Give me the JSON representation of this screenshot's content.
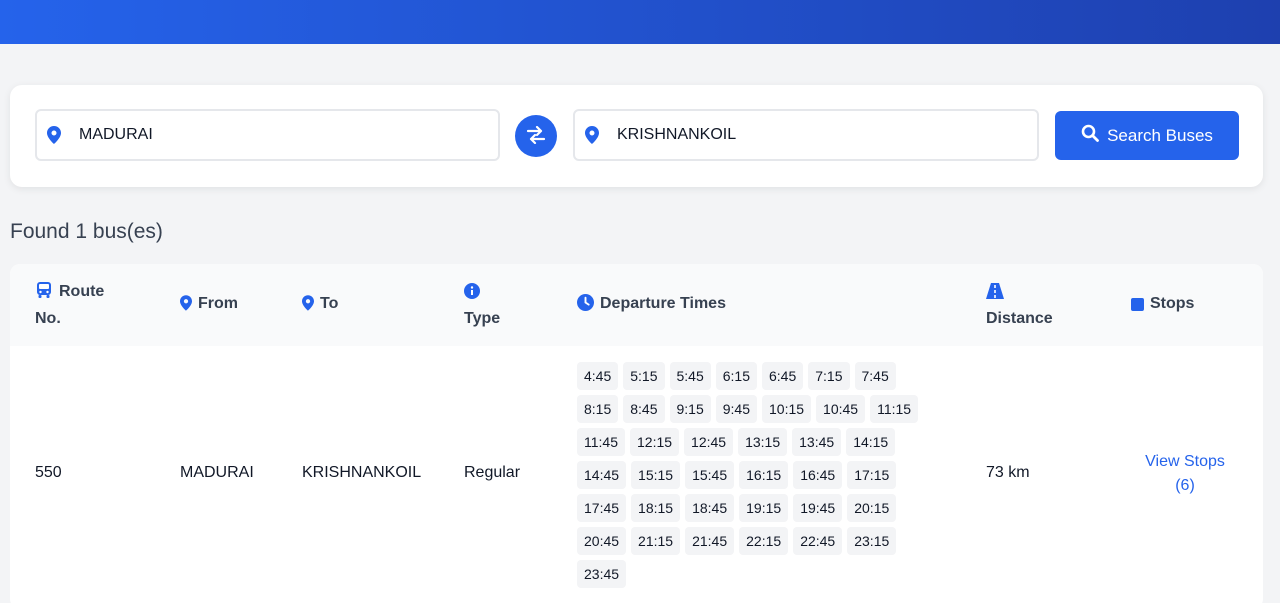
{
  "search": {
    "from_value": "MADURAI",
    "to_value": "KRISHNANKOIL",
    "search_label": "Search Buses"
  },
  "results": {
    "found_text": "Found 1 bus(es)"
  },
  "table": {
    "headers": {
      "route_line1": "Route",
      "route_line2": "No.",
      "from": "From",
      "to": "To",
      "type": "Type",
      "departure": "Departure Times",
      "distance": "Distance",
      "stops": "Stops"
    },
    "row": {
      "route_no": "550",
      "from": "MADURAI",
      "to": "KRISHNANKOIL",
      "type": "Regular",
      "distance": "73 km",
      "view_stops": "View Stops",
      "stops_count": "(6)",
      "times": [
        "4:45",
        "5:15",
        "5:45",
        "6:15",
        "6:45",
        "7:15",
        "7:45",
        "8:15",
        "8:45",
        "9:15",
        "9:45",
        "10:15",
        "10:45",
        "11:15",
        "11:45",
        "12:15",
        "12:45",
        "13:15",
        "13:45",
        "14:15",
        "14:45",
        "15:15",
        "15:45",
        "16:15",
        "16:45",
        "17:15",
        "17:45",
        "18:15",
        "18:45",
        "19:15",
        "19:45",
        "20:15",
        "20:45",
        "21:15",
        "21:45",
        "22:15",
        "22:45",
        "23:15",
        "23:45"
      ]
    }
  },
  "colors": {
    "accent": "#2563eb",
    "header_gradient_end": "#1e40af"
  },
  "icons": {
    "pin": "map-pin-icon",
    "swap": "swap-arrows-icon",
    "search": "search-icon",
    "bus": "bus-icon",
    "info": "info-icon",
    "clock": "clock-icon",
    "road": "road-icon",
    "stop": "stop-square-icon"
  }
}
